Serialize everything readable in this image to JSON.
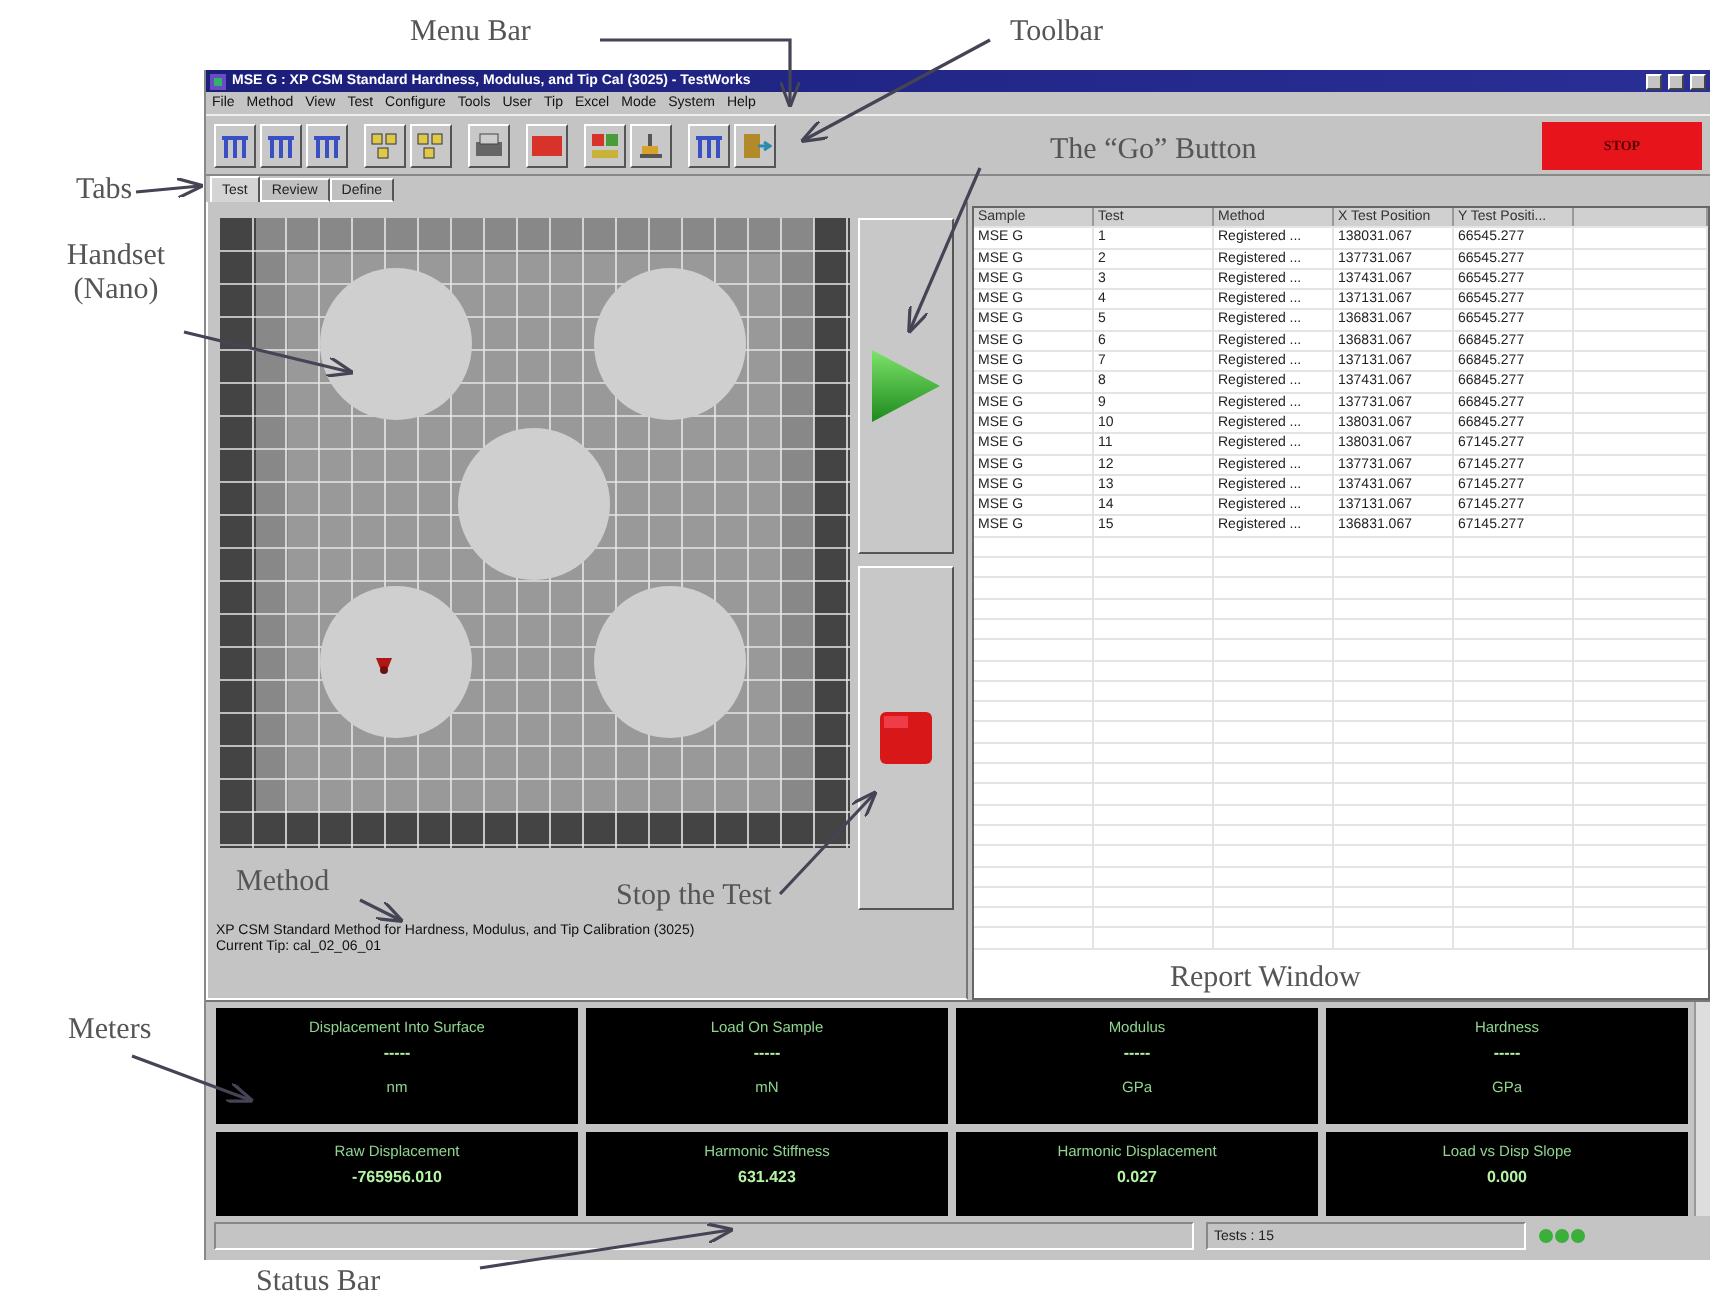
{
  "annotations": [
    {
      "text": "Menu Bar"
    },
    {
      "text": "Toolbar"
    },
    {
      "text": "The “Go” Button"
    },
    {
      "text": "Tabs"
    },
    {
      "text": "Handset (Nano)"
    },
    {
      "text": "Method"
    },
    {
      "text": "Stop the Test"
    },
    {
      "text": "Report Window"
    },
    {
      "text": "Meters"
    },
    {
      "text": "Status Bar"
    }
  ],
  "window": {
    "title": "MSE G : XP CSM Standard Hardness, Modulus, and Tip Cal (3025) - TestWorks"
  },
  "menu": [
    "File",
    "Method",
    "View",
    "Test",
    "Configure",
    "Tools",
    "User",
    "Tip",
    "Excel",
    "Mode",
    "System",
    "Help"
  ],
  "stop_button": "STOP",
  "tabs": [
    {
      "label": "Test",
      "selected": true
    },
    {
      "label": "Review",
      "selected": false
    },
    {
      "label": "Define",
      "selected": false
    }
  ],
  "method": {
    "name": "XP CSM Standard Method for Hardness, Modulus, and Tip Calibration (3025)",
    "tip": "Current Tip: cal_02_06_01"
  },
  "table": {
    "columns": [
      "Sample",
      "Test",
      "Method",
      "X Test Position",
      "Y Test Positi..."
    ],
    "rows": [
      [
        "MSE G",
        "1",
        "Registered ...",
        "138031.067",
        "66545.277"
      ],
      [
        "MSE G",
        "2",
        "Registered ...",
        "137731.067",
        "66545.277"
      ],
      [
        "MSE G",
        "3",
        "Registered ...",
        "137431.067",
        "66545.277"
      ],
      [
        "MSE G",
        "4",
        "Registered ...",
        "137131.067",
        "66545.277"
      ],
      [
        "MSE G",
        "5",
        "Registered ...",
        "136831.067",
        "66545.277"
      ],
      [
        "MSE G",
        "6",
        "Registered ...",
        "136831.067",
        "66845.277"
      ],
      [
        "MSE G",
        "7",
        "Registered ...",
        "137131.067",
        "66845.277"
      ],
      [
        "MSE G",
        "8",
        "Registered ...",
        "137431.067",
        "66845.277"
      ],
      [
        "MSE G",
        "9",
        "Registered ...",
        "137731.067",
        "66845.277"
      ],
      [
        "MSE G",
        "10",
        "Registered ...",
        "138031.067",
        "66845.277"
      ],
      [
        "MSE G",
        "11",
        "Registered ...",
        "138031.067",
        "67145.277"
      ],
      [
        "MSE G",
        "12",
        "Registered ...",
        "137731.067",
        "67145.277"
      ],
      [
        "MSE G",
        "13",
        "Registered ...",
        "137431.067",
        "67145.277"
      ],
      [
        "MSE G",
        "14",
        "Registered ...",
        "137131.067",
        "67145.277"
      ],
      [
        "MSE G",
        "15",
        "Registered ...",
        "136831.067",
        "67145.277"
      ]
    ]
  },
  "meters": [
    {
      "label": "Displacement Into Surface",
      "value": "-----",
      "unit": "nm"
    },
    {
      "label": "Load On Sample",
      "value": "-----",
      "unit": "mN"
    },
    {
      "label": "Modulus",
      "value": "-----",
      "unit": "GPa"
    },
    {
      "label": "Hardness",
      "value": "-----",
      "unit": "GPa"
    },
    {
      "label": "Raw Displacement",
      "value": "-765956.010"
    },
    {
      "label": "Harmonic Stiffness",
      "value": "631.423"
    },
    {
      "label": "Harmonic Displacement",
      "value": "0.027"
    },
    {
      "label": "Load vs Disp Slope",
      "value": "0.000"
    }
  ],
  "status_bar": {
    "tests": "Tests : 15"
  }
}
